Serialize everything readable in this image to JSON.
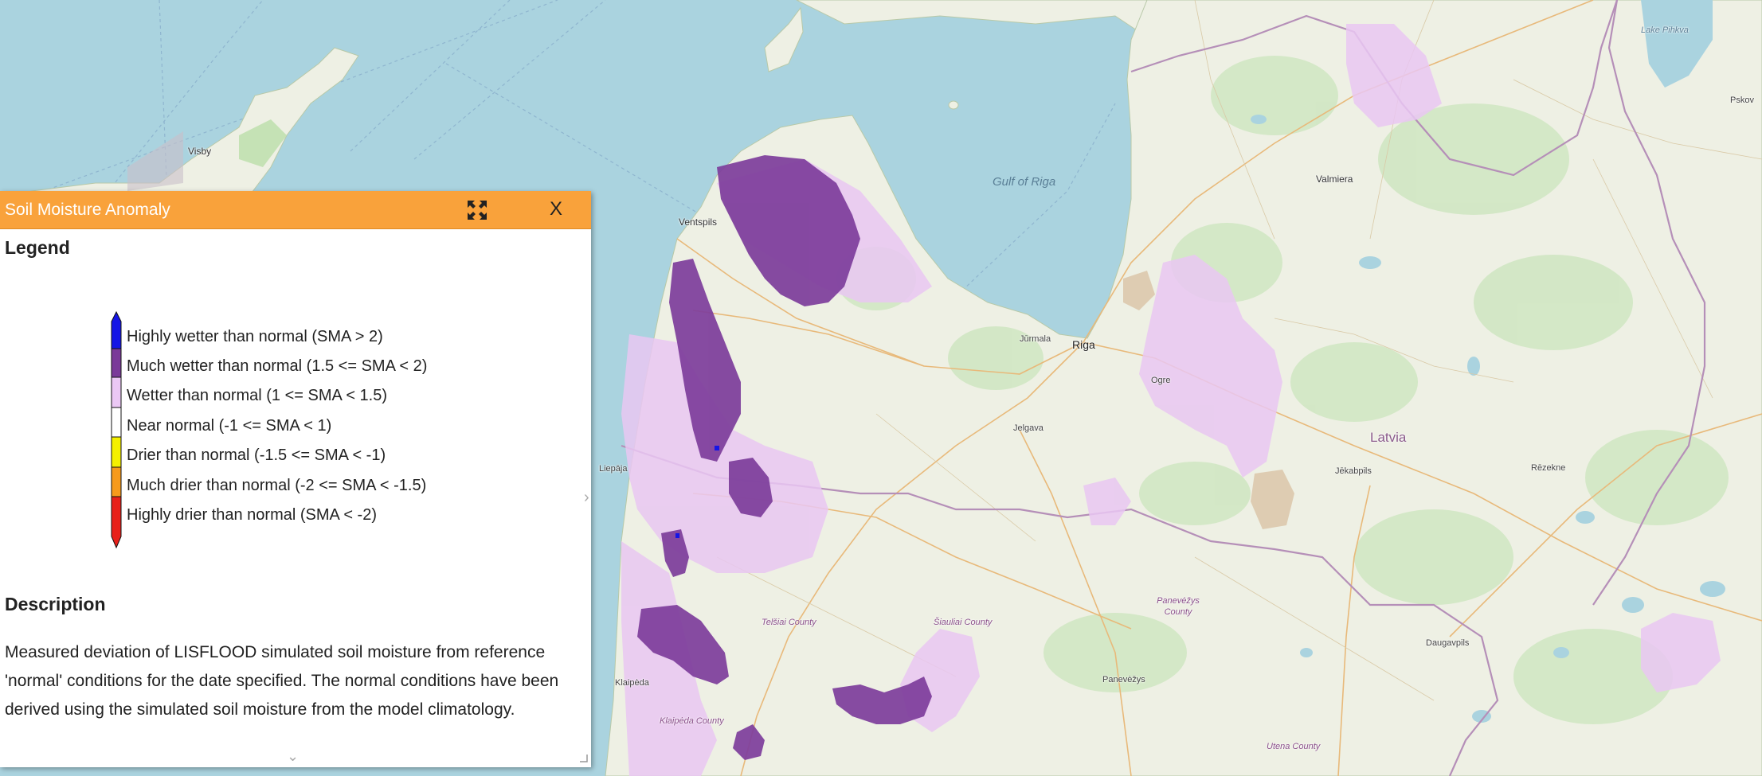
{
  "panel": {
    "title": "Soil Moisture Anomaly",
    "legend_heading": "Legend",
    "legend_items": [
      {
        "label": "Highly wetter than normal (SMA > 2)",
        "color": "#1515e6"
      },
      {
        "label": "Much wetter than normal (1.5 <= SMA < 2)",
        "color": "#7a3a99"
      },
      {
        "label": "Wetter than normal (1 <= SMA < 1.5)",
        "color": "#ebc8f5"
      },
      {
        "label": "Near normal (-1 <= SMA < 1)",
        "color": "#ffffff"
      },
      {
        "label": "Drier than normal (-1.5 <= SMA < -1)",
        "color": "#f5f000"
      },
      {
        "label": "Much drier than normal (-2 <= SMA < -1.5)",
        "color": "#f79a1c"
      },
      {
        "label": "Highly drier than normal (SMA < -2)",
        "color": "#e8201a"
      }
    ],
    "description_heading": "Description",
    "description": "Measured deviation of LISFLOOD simulated soil moisture from reference 'normal' conditions for the date specified. The normal conditions have been derived using the simulated soil moisture from the model climatology.",
    "header_color": "#f9a23b",
    "expand_icon": "expand-arrows-icon",
    "close_label": "X"
  },
  "map": {
    "sea_color": "#aad3df",
    "land_color": "#eef0e4",
    "places": {
      "visby": "Visby",
      "ventspils": "Ventspils",
      "gulf": "Gulf of Riga",
      "valmiera": "Valmiera",
      "jurmala": "Jūrmala",
      "riga": "Riga",
      "ogre": "Ogre",
      "jelgava": "Jelgava",
      "latvia": "Latvia",
      "liepaja": "Liepāja",
      "jekabpils": "Jēkabpils",
      "rezekne": "Rēzekne",
      "telsiai": "Telšiai County",
      "siauliai": "Šiauliai County",
      "panevezys_county": "Panevėžys County",
      "klaipeda": "Klaipėda",
      "klaipeda_county": "Klaipėda County",
      "panevezys": "Panevėžys",
      "daugavpils": "Daugavpils",
      "utena": "Utena County",
      "pskov": "Pskov",
      "lake_pihkva": "Lake Pihkva"
    }
  }
}
